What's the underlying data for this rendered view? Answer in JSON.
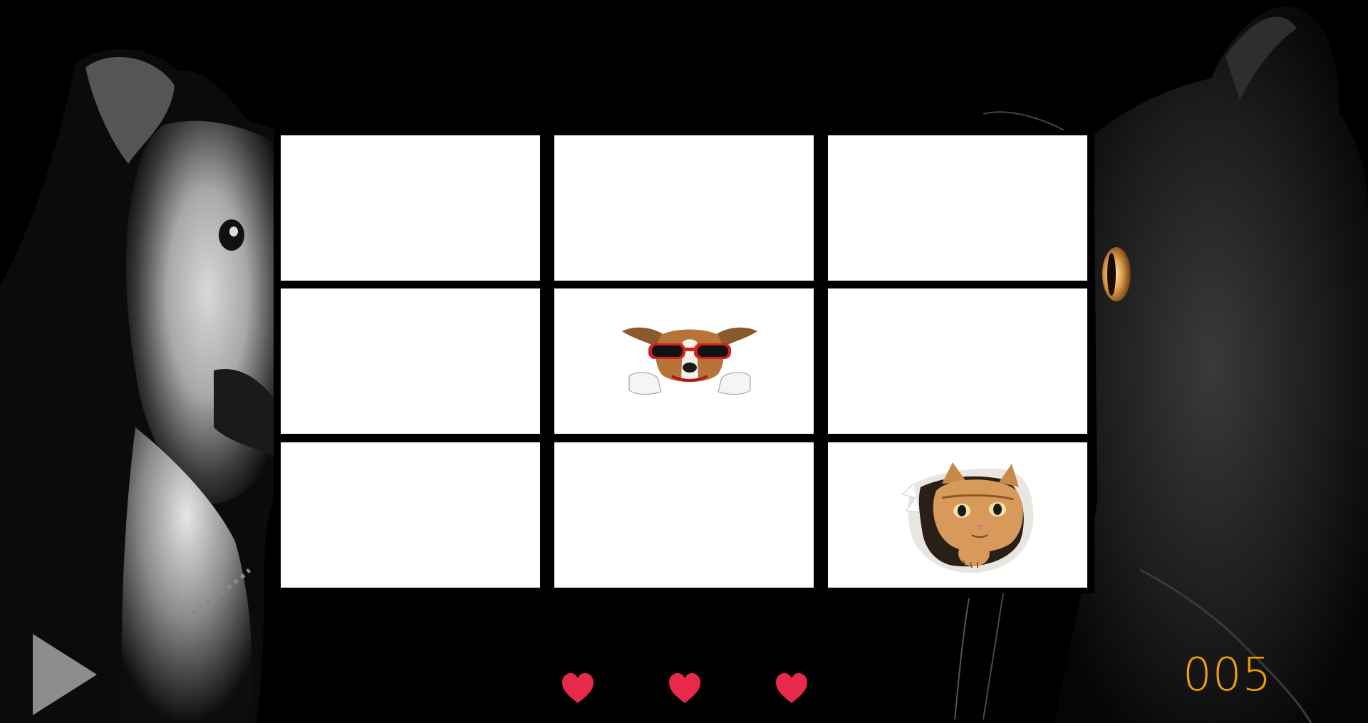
{
  "game": {
    "board": {
      "rows": 3,
      "cols": 3,
      "cells": [
        {
          "row": 1,
          "col": 1,
          "content": "empty"
        },
        {
          "row": 1,
          "col": 2,
          "content": "empty"
        },
        {
          "row": 1,
          "col": 3,
          "content": "empty"
        },
        {
          "row": 2,
          "col": 1,
          "content": "empty"
        },
        {
          "row": 2,
          "col": 2,
          "content": "dog-with-red-sunglasses"
        },
        {
          "row": 2,
          "col": 3,
          "content": "empty"
        },
        {
          "row": 3,
          "col": 1,
          "content": "empty"
        },
        {
          "row": 3,
          "col": 2,
          "content": "empty"
        },
        {
          "row": 3,
          "col": 3,
          "content": "cat-peeking-through-paper"
        }
      ]
    },
    "lives": {
      "count": 3,
      "icon": "heart-icon",
      "color": "#e8294a"
    },
    "score": {
      "value": "005",
      "color": "#f0a000"
    },
    "controls": {
      "play_icon": "play-icon",
      "play_color": "#8c8c8c"
    },
    "background": {
      "left": "dog-portrait",
      "right": "black-cat-portrait"
    }
  }
}
